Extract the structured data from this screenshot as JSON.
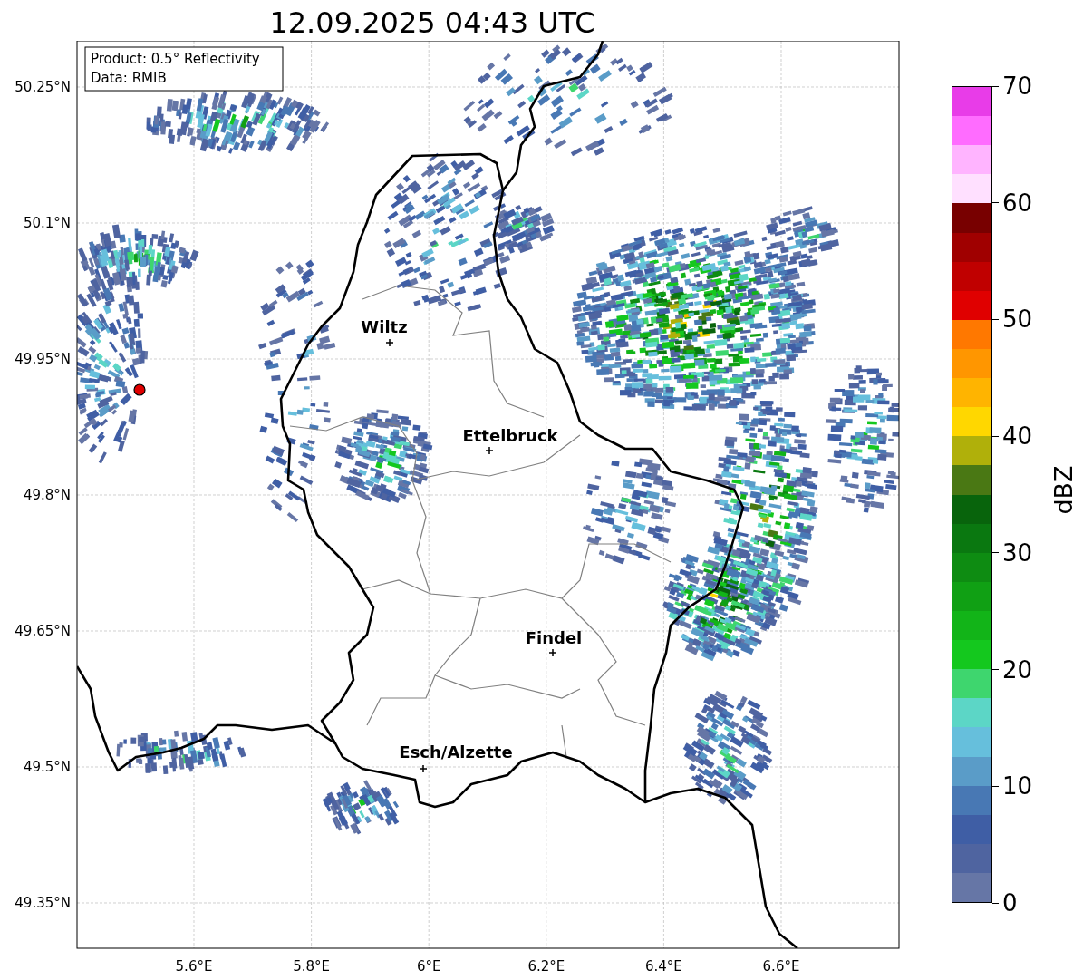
{
  "title": "12.09.2025 04:43 UTC",
  "info_box": [
    "Product: 0.5° Reflectivity",
    "Data: RMIB"
  ],
  "map": {
    "lat_ticks": [
      "50.25°N",
      "50.1°N",
      "49.95°N",
      "49.8°N",
      "49.65°N",
      "49.5°N",
      "49.35°N"
    ],
    "lon_ticks": [
      "5.6°E",
      "5.8°E",
      "6°E",
      "6.2°E",
      "6.4°E",
      "6.6°E"
    ],
    "cities": [
      {
        "name": "Wiltz"
      },
      {
        "name": "Ettelbruck"
      },
      {
        "name": "Findel"
      },
      {
        "name": "Esch/Alzette"
      }
    ]
  },
  "colorbar": {
    "label": "dBZ",
    "ticks": [
      "70",
      "60",
      "50",
      "40",
      "30",
      "20",
      "10",
      "0"
    ],
    "bins": [
      {
        "color": "#e83ce8"
      },
      {
        "color": "#ff6cff"
      },
      {
        "color": "#ffb4ff"
      },
      {
        "color": "#ffe0ff"
      },
      {
        "color": "#780000"
      },
      {
        "color": "#a00000"
      },
      {
        "color": "#c00000"
      },
      {
        "color": "#e00000"
      },
      {
        "color": "#ff7800"
      },
      {
        "color": "#ff9600"
      },
      {
        "color": "#ffb400"
      },
      {
        "color": "#ffd700"
      },
      {
        "color": "#b0b00a"
      },
      {
        "color": "#4a7814"
      },
      {
        "color": "#08640c"
      },
      {
        "color": "#0a7810"
      },
      {
        "color": "#0e8c12"
      },
      {
        "color": "#10a014"
      },
      {
        "color": "#12b418"
      },
      {
        "color": "#14c81e"
      },
      {
        "color": "#3ed66e"
      },
      {
        "color": "#5cd6c6"
      },
      {
        "color": "#66bfdc"
      },
      {
        "color": "#5a9cc8"
      },
      {
        "color": "#4878b4"
      },
      {
        "color": "#3f5ea5"
      },
      {
        "color": "#4f64a0"
      },
      {
        "color": "#6676a6"
      }
    ]
  }
}
